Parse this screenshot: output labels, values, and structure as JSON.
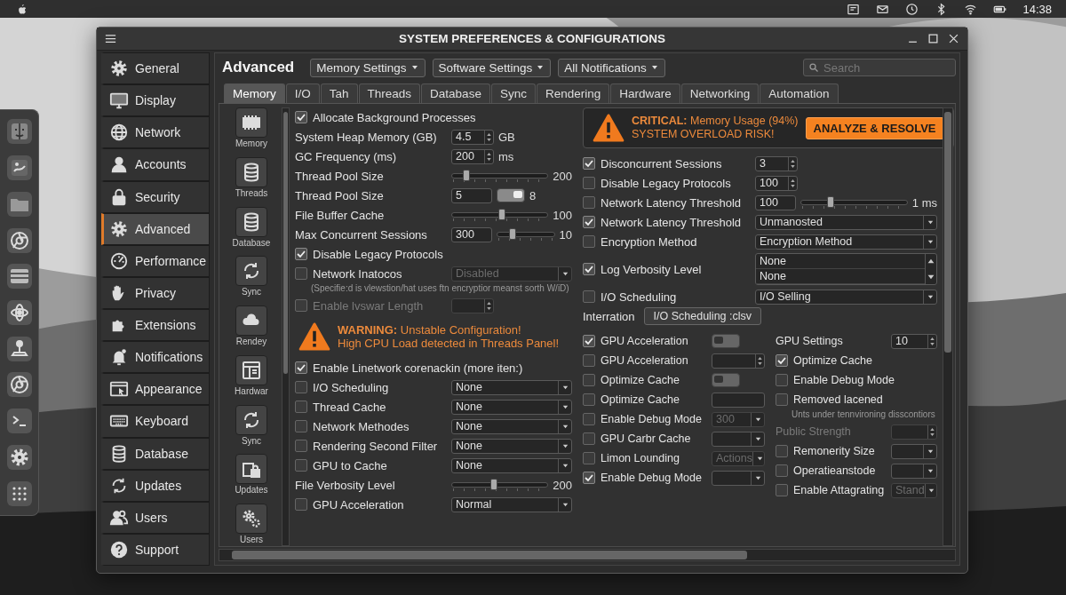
{
  "menubar": {
    "clock": "14:38"
  },
  "window": {
    "title": "SYSTEM PREFERENCES & CONFIGURATIONS"
  },
  "sidebar": {
    "items": [
      {
        "label": "General",
        "selected": false
      },
      {
        "label": "Display",
        "selected": false
      },
      {
        "label": "Network",
        "selected": false
      },
      {
        "label": "Accounts",
        "selected": false
      },
      {
        "label": "Security",
        "selected": false
      },
      {
        "label": "Advanced",
        "selected": true
      },
      {
        "label": "Performance",
        "selected": false
      },
      {
        "label": "Privacy",
        "selected": false
      },
      {
        "label": "Extensions",
        "selected": false
      },
      {
        "label": "Notifications",
        "selected": false
      },
      {
        "label": "Appearance",
        "selected": false
      },
      {
        "label": "Keyboard",
        "selected": false
      },
      {
        "label": "Database",
        "selected": false
      },
      {
        "label": "Updates",
        "selected": false
      },
      {
        "label": "Users",
        "selected": false
      },
      {
        "label": "Support",
        "selected": false
      }
    ]
  },
  "header": {
    "title": "Advanced",
    "dropdowns": [
      "Memory Settings",
      "Software Settings",
      "All Notifications"
    ],
    "search": {
      "placeholder": "Search"
    }
  },
  "tabs": [
    {
      "label": "Memory",
      "selected": true
    },
    {
      "label": "I/O",
      "selected": false
    },
    {
      "label": "Tah",
      "selected": false
    },
    {
      "label": "Threads",
      "selected": false
    },
    {
      "label": "Database",
      "selected": false
    },
    {
      "label": "Sync",
      "selected": false
    },
    {
      "label": "Rendering",
      "selected": false
    },
    {
      "label": "Hardware",
      "selected": false
    },
    {
      "label": "Networking",
      "selected": false
    },
    {
      "label": "Automation",
      "selected": false
    }
  ],
  "subnav": [
    "Memory",
    "Threads",
    "Database",
    "Sync",
    "Rendey",
    "Hardwar",
    "Sync",
    "Updates",
    "Users"
  ],
  "content": {
    "left": [
      {
        "kind": "check",
        "label": "Allocate Background Processes",
        "checked": true,
        "disabled": false
      },
      {
        "kind": "plain",
        "label": "System Heap Memory (GB)",
        "disabled": false,
        "controls": [
          {
            "kind": "spin",
            "value": "4.5",
            "disabled": false
          },
          {
            "kind": "text",
            "text": "GB"
          }
        ]
      },
      {
        "kind": "plain",
        "label": "GC Frequency (ms)",
        "disabled": false,
        "controls": [
          {
            "kind": "spin",
            "value": "200",
            "disabled": false
          },
          {
            "kind": "text",
            "text": "ms"
          }
        ]
      },
      {
        "kind": "plain",
        "label": "Thread Pool Size",
        "disabled": false,
        "controls": [
          {
            "kind": "slider",
            "level": 0.16
          },
          {
            "kind": "text",
            "text": "200"
          }
        ]
      },
      {
        "kind": "plain",
        "label": "Thread Pool Size",
        "disabled": false,
        "controls": [
          {
            "kind": "field",
            "value": "5"
          },
          {
            "kind": "switch",
            "on": true
          },
          {
            "kind": "text",
            "text": "8"
          }
        ]
      },
      {
        "kind": "plain",
        "label": "File Buffer Cache",
        "disabled": false,
        "controls": [
          {
            "kind": "slider",
            "level": 0.52
          },
          {
            "kind": "text",
            "text": "100"
          }
        ]
      },
      {
        "kind": "plain",
        "label": "Max Concurrent Sessions",
        "disabled": false,
        "controls": [
          {
            "kind": "field",
            "value": "300"
          },
          {
            "kind": "slider",
            "level": 0.28
          },
          {
            "kind": "text",
            "text": "10"
          }
        ]
      },
      {
        "kind": "check",
        "label": "Disable Legacy Protocols",
        "checked": true,
        "disabled": false
      },
      {
        "kind": "check",
        "label": "Network Inatocos",
        "checked": false,
        "disabled": false,
        "controls": [
          {
            "kind": "select",
            "value": "Disabled",
            "disabled": true
          }
        ]
      },
      {
        "kind": "note",
        "text": "(Specifie:d is vlewstion/hat uses ftn encryptior meanst sorth W/iD)"
      },
      {
        "kind": "check",
        "label": "Enable lvswar Length",
        "checked": false,
        "disabled": true,
        "controls": [
          {
            "kind": "spin",
            "disabled": true
          }
        ]
      },
      {
        "kind": "warning",
        "lines": [
          "**WARNING:** Unstable Configuration!",
          "High CPU Load detected in Threads Panel!"
        ]
      },
      {
        "kind": "check",
        "label": "Enable Linetwork corenackin (more iten:)",
        "checked": true,
        "disabled": false
      },
      {
        "kind": "check",
        "label": "I/O Scheduling",
        "checked": false,
        "disabled": false,
        "controls": [
          {
            "kind": "select",
            "value": "None",
            "disabled": false
          }
        ]
      },
      {
        "kind": "check",
        "label": "Thread Cache",
        "checked": false,
        "disabled": false,
        "controls": [
          {
            "kind": "select",
            "value": "None",
            "disabled": false
          }
        ]
      },
      {
        "kind": "check",
        "label": "Network Methodes",
        "checked": false,
        "disabled": false,
        "controls": [
          {
            "kind": "select",
            "value": "None",
            "disabled": false
          }
        ]
      },
      {
        "kind": "check",
        "label": "Rendering Second Filter",
        "checked": false,
        "disabled": false,
        "controls": [
          {
            "kind": "select",
            "value": "None",
            "disabled": false
          }
        ]
      },
      {
        "kind": "check",
        "label": "GPU to Cache",
        "checked": false,
        "disabled": false,
        "controls": [
          {
            "kind": "select",
            "value": "None",
            "disabled": false
          }
        ]
      },
      {
        "kind": "plain",
        "label": "File Verbosity Level",
        "disabled": false,
        "controls": [
          {
            "kind": "slider",
            "level": 0.44
          },
          {
            "kind": "text",
            "text": "200"
          }
        ]
      },
      {
        "kind": "check",
        "label": "GPU Acceleration",
        "checked": false,
        "disabled": false,
        "controls": [
          {
            "kind": "select",
            "value": "Normal",
            "disabled": false
          }
        ]
      }
    ],
    "right_top": [
      {
        "kind": "alert",
        "lines": [
          "**CRITICAL:** Memory Usage (94%)",
          "SYSTEM OVERLOAD RISK!"
        ],
        "action": "ANALYZE & RESOLVE"
      },
      {
        "kind": "check",
        "label": "Disconcurrent Sessions",
        "checked": true,
        "disabled": false,
        "controls": [
          {
            "kind": "spin",
            "value": "3",
            "disabled": false
          }
        ]
      },
      {
        "kind": "check",
        "label": "Disable Legacy Protocols",
        "checked": false,
        "disabled": false,
        "controls": [
          {
            "kind": "spin",
            "value": "100",
            "disabled": false
          }
        ]
      },
      {
        "kind": "check",
        "label": "Network Latency Threshold",
        "checked": false,
        "disabled": false,
        "controls": [
          {
            "kind": "field",
            "value": "100"
          },
          {
            "kind": "slider",
            "level": 0.28
          },
          {
            "kind": "text",
            "text": "1 ms"
          }
        ]
      },
      {
        "kind": "check",
        "label": "Network Latency Threshold",
        "checked": true,
        "disabled": false,
        "controls": [
          {
            "kind": "select",
            "value": "Unmanosted",
            "disabled": false
          }
        ]
      },
      {
        "kind": "check",
        "label": "Encryption Method",
        "checked": false,
        "disabled": false,
        "controls": [
          {
            "kind": "select",
            "value": "Encryption Method",
            "disabled": false
          }
        ]
      },
      {
        "kind": "check",
        "label": "Log Verbosity Level",
        "checked": true,
        "disabled": false,
        "controls": [
          {
            "kind": "listbox",
            "options": [
              "None",
              "None"
            ]
          }
        ]
      },
      {
        "kind": "check",
        "label": "I/O Scheduling",
        "checked": false,
        "disabled": false,
        "controls": [
          {
            "kind": "select",
            "value": "I/O Selling",
            "disabled": false
          }
        ]
      },
      {
        "kind": "plain",
        "label": "Interration",
        "disabled": false,
        "controls": [
          {
            "kind": "button",
            "label": "I/O Scheduling :clsv"
          }
        ]
      }
    ],
    "right_lower_left": [
      {
        "kind": "check",
        "label": "GPU Acceleration",
        "checked": true,
        "disabled": false,
        "controls": [
          {
            "kind": "switch",
            "on": false
          }
        ]
      },
      {
        "kind": "check",
        "label": "GPU Acceleration",
        "checked": false,
        "disabled": false,
        "controls": [
          {
            "kind": "spin",
            "disabled": false
          }
        ]
      },
      {
        "kind": "check",
        "label": "Optimize Cache",
        "checked": false,
        "disabled": false,
        "controls": [
          {
            "kind": "switch",
            "on": false
          }
        ]
      },
      {
        "kind": "check",
        "label": "Optimize Cache",
        "checked": false,
        "disabled": false,
        "controls": [
          {
            "kind": "field"
          }
        ]
      },
      {
        "kind": "check",
        "label": "Enable Debug Mode",
        "checked": false,
        "disabled": false,
        "controls": [
          {
            "kind": "select",
            "value": "300",
            "disabled": true
          }
        ]
      },
      {
        "kind": "check",
        "label": "GPU Carbr Cache",
        "checked": false,
        "disabled": false,
        "controls": [
          {
            "kind": "select",
            "disabled": false
          }
        ]
      },
      {
        "kind": "check",
        "label": "Limon Lounding",
        "checked": false,
        "disabled": false,
        "controls": [
          {
            "kind": "select",
            "value": "Actions",
            "disabled": true
          }
        ]
      },
      {
        "kind": "check",
        "label": "Enable Debug Mode",
        "checked": true,
        "disabled": false,
        "controls": [
          {
            "kind": "select",
            "disabled": false
          }
        ]
      }
    ],
    "right_lower_right": [
      {
        "kind": "plain",
        "label": "GPU Settings",
        "disabled": false,
        "controls": [
          {
            "kind": "spin",
            "value": "10",
            "disabled": false
          }
        ]
      },
      {
        "kind": "check",
        "label": "Optimize Cache",
        "checked": true,
        "disabled": false
      },
      {
        "kind": "check",
        "label": "Enable Debug Mode",
        "checked": false,
        "disabled": false
      },
      {
        "kind": "check",
        "label": "Removed lacened",
        "checked": false,
        "disabled": false
      },
      {
        "kind": "note",
        "text": "Unts under tennvironing disscontiors"
      },
      {
        "kind": "plain",
        "label": "Public Strength",
        "disabled": true,
        "controls": [
          {
            "kind": "spin",
            "disabled": true
          }
        ]
      },
      {
        "kind": "check",
        "label": "Remonerity Size",
        "checked": false,
        "disabled": false,
        "controls": [
          {
            "kind": "select",
            "disabled": false
          }
        ]
      },
      {
        "kind": "check",
        "label": "Operatieanstode",
        "checked": false,
        "disabled": false,
        "controls": [
          {
            "kind": "select",
            "disabled": false
          }
        ]
      },
      {
        "kind": "check",
        "label": "Enable Attagrating",
        "checked": false,
        "disabled": false,
        "controls": [
          {
            "kind": "select",
            "value": "Stand",
            "disabled": true
          }
        ]
      }
    ]
  }
}
